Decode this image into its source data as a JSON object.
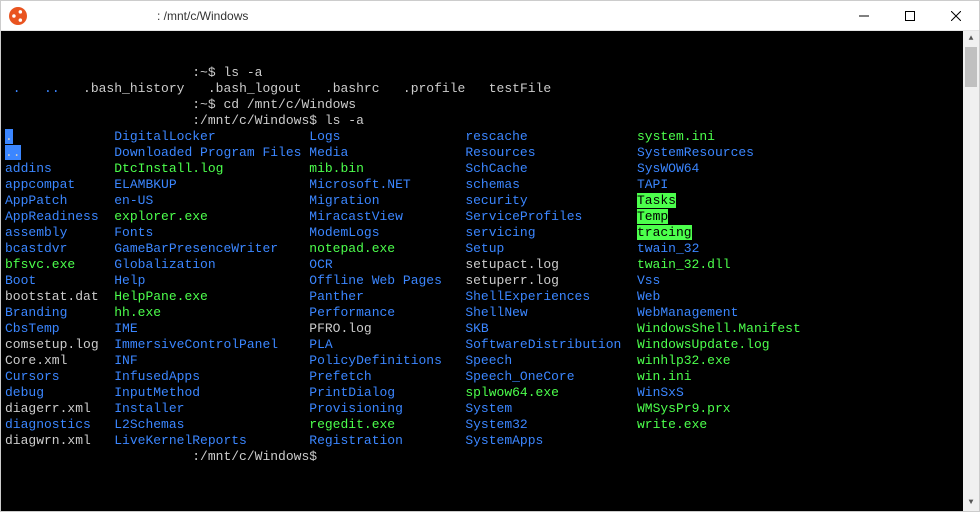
{
  "window": {
    "title": ": /mnt/c/Windows"
  },
  "prompt": {
    "home": ":~$ ",
    "cwd_label": ":/mnt/c/Windows$ "
  },
  "history": {
    "cmd1": "ls -a",
    "out1_a": ".",
    "out1_b": "..",
    "out1_c": ".bash_history",
    "out1_d": ".bash_logout",
    "out1_e": ".bashrc",
    "out1_f": ".profile",
    "out1_g": "testFile",
    "cmd2": "cd /mnt/c/Windows",
    "cmd3": "ls -a"
  },
  "cols": {
    "c0": 14,
    "c1": 25,
    "c2": 20,
    "c3": 22,
    "c4": 24
  },
  "listing": [
    [
      {
        "t": ".",
        "c": "c-hidden"
      },
      {
        "t": "DigitalLocker",
        "c": "c-dir"
      },
      {
        "t": "Logs",
        "c": "c-dir"
      },
      {
        "t": "rescache",
        "c": "c-dir"
      },
      {
        "t": "system.ini",
        "c": "c-exec"
      }
    ],
    [
      {
        "t": "..",
        "c": "c-hidden"
      },
      {
        "t": "Downloaded Program Files",
        "c": "c-dir"
      },
      {
        "t": "Media",
        "c": "c-dir"
      },
      {
        "t": "Resources",
        "c": "c-dir"
      },
      {
        "t": "SystemResources",
        "c": "c-dir"
      }
    ],
    [
      {
        "t": "addins",
        "c": "c-dir"
      },
      {
        "t": "DtcInstall.log",
        "c": "c-exec"
      },
      {
        "t": "mib.bin",
        "c": "c-exec"
      },
      {
        "t": "SchCache",
        "c": "c-dir"
      },
      {
        "t": "SysWOW64",
        "c": "c-dir"
      }
    ],
    [
      {
        "t": "appcompat",
        "c": "c-dir"
      },
      {
        "t": "ELAMBKUP",
        "c": "c-dir"
      },
      {
        "t": "Microsoft.NET",
        "c": "c-dir"
      },
      {
        "t": "schemas",
        "c": "c-dir"
      },
      {
        "t": "TAPI",
        "c": "c-dir"
      }
    ],
    [
      {
        "t": "AppPatch",
        "c": "c-dir"
      },
      {
        "t": "en-US",
        "c": "c-dir"
      },
      {
        "t": "Migration",
        "c": "c-dir"
      },
      {
        "t": "security",
        "c": "c-dir"
      },
      {
        "t": "Tasks",
        "c": "c-sticky"
      }
    ],
    [
      {
        "t": "AppReadiness",
        "c": "c-dir"
      },
      {
        "t": "explorer.exe",
        "c": "c-exec"
      },
      {
        "t": "MiracastView",
        "c": "c-dir"
      },
      {
        "t": "ServiceProfiles",
        "c": "c-dir"
      },
      {
        "t": "Temp",
        "c": "c-sticky"
      }
    ],
    [
      {
        "t": "assembly",
        "c": "c-dir"
      },
      {
        "t": "Fonts",
        "c": "c-dir"
      },
      {
        "t": "ModemLogs",
        "c": "c-dir"
      },
      {
        "t": "servicing",
        "c": "c-dir"
      },
      {
        "t": "tracing",
        "c": "c-sticky"
      }
    ],
    [
      {
        "t": "bcastdvr",
        "c": "c-dir"
      },
      {
        "t": "GameBarPresenceWriter",
        "c": "c-dir"
      },
      {
        "t": "notepad.exe",
        "c": "c-exec"
      },
      {
        "t": "Setup",
        "c": "c-dir"
      },
      {
        "t": "twain_32",
        "c": "c-dir"
      }
    ],
    [
      {
        "t": "bfsvc.exe",
        "c": "c-exec"
      },
      {
        "t": "Globalization",
        "c": "c-dir"
      },
      {
        "t": "OCR",
        "c": "c-dir"
      },
      {
        "t": "setupact.log",
        "c": "c-file"
      },
      {
        "t": "twain_32.dll",
        "c": "c-exec"
      }
    ],
    [
      {
        "t": "Boot",
        "c": "c-dir"
      },
      {
        "t": "Help",
        "c": "c-dir"
      },
      {
        "t": "Offline Web Pages",
        "c": "c-dir"
      },
      {
        "t": "setuperr.log",
        "c": "c-file"
      },
      {
        "t": "Vss",
        "c": "c-dir"
      }
    ],
    [
      {
        "t": "bootstat.dat",
        "c": "c-file"
      },
      {
        "t": "HelpPane.exe",
        "c": "c-exec"
      },
      {
        "t": "Panther",
        "c": "c-dir"
      },
      {
        "t": "ShellExperiences",
        "c": "c-dir"
      },
      {
        "t": "Web",
        "c": "c-dir"
      }
    ],
    [
      {
        "t": "Branding",
        "c": "c-dir"
      },
      {
        "t": "hh.exe",
        "c": "c-exec"
      },
      {
        "t": "Performance",
        "c": "c-dir"
      },
      {
        "t": "ShellNew",
        "c": "c-dir"
      },
      {
        "t": "WebManagement",
        "c": "c-dir"
      }
    ],
    [
      {
        "t": "CbsTemp",
        "c": "c-dir"
      },
      {
        "t": "IME",
        "c": "c-dir"
      },
      {
        "t": "PFRO.log",
        "c": "c-file"
      },
      {
        "t": "SKB",
        "c": "c-dir"
      },
      {
        "t": "WindowsShell.Manifest",
        "c": "c-exec"
      }
    ],
    [
      {
        "t": "comsetup.log",
        "c": "c-file"
      },
      {
        "t": "ImmersiveControlPanel",
        "c": "c-dir"
      },
      {
        "t": "PLA",
        "c": "c-dir"
      },
      {
        "t": "SoftwareDistribution",
        "c": "c-dir"
      },
      {
        "t": "WindowsUpdate.log",
        "c": "c-exec"
      }
    ],
    [
      {
        "t": "Core.xml",
        "c": "c-file"
      },
      {
        "t": "INF",
        "c": "c-dir"
      },
      {
        "t": "PolicyDefinitions",
        "c": "c-dir"
      },
      {
        "t": "Speech",
        "c": "c-dir"
      },
      {
        "t": "winhlp32.exe",
        "c": "c-exec"
      }
    ],
    [
      {
        "t": "Cursors",
        "c": "c-dir"
      },
      {
        "t": "InfusedApps",
        "c": "c-dir"
      },
      {
        "t": "Prefetch",
        "c": "c-dir"
      },
      {
        "t": "Speech_OneCore",
        "c": "c-dir"
      },
      {
        "t": "win.ini",
        "c": "c-exec"
      }
    ],
    [
      {
        "t": "debug",
        "c": "c-dir"
      },
      {
        "t": "InputMethod",
        "c": "c-dir"
      },
      {
        "t": "PrintDialog",
        "c": "c-dir"
      },
      {
        "t": "splwow64.exe",
        "c": "c-exec"
      },
      {
        "t": "WinSxS",
        "c": "c-dir"
      }
    ],
    [
      {
        "t": "diagerr.xml",
        "c": "c-file"
      },
      {
        "t": "Installer",
        "c": "c-dir"
      },
      {
        "t": "Provisioning",
        "c": "c-dir"
      },
      {
        "t": "System",
        "c": "c-dir"
      },
      {
        "t": "WMSysPr9.prx",
        "c": "c-exec"
      }
    ],
    [
      {
        "t": "diagnostics",
        "c": "c-dir"
      },
      {
        "t": "L2Schemas",
        "c": "c-dir"
      },
      {
        "t": "regedit.exe",
        "c": "c-exec"
      },
      {
        "t": "System32",
        "c": "c-dir"
      },
      {
        "t": "write.exe",
        "c": "c-exec"
      }
    ],
    [
      {
        "t": "diagwrn.xml",
        "c": "c-file"
      },
      {
        "t": "LiveKernelReports",
        "c": "c-dir"
      },
      {
        "t": "Registration",
        "c": "c-dir"
      },
      {
        "t": "SystemApps",
        "c": "c-dir"
      },
      {
        "t": "",
        "c": "c-file"
      }
    ]
  ]
}
